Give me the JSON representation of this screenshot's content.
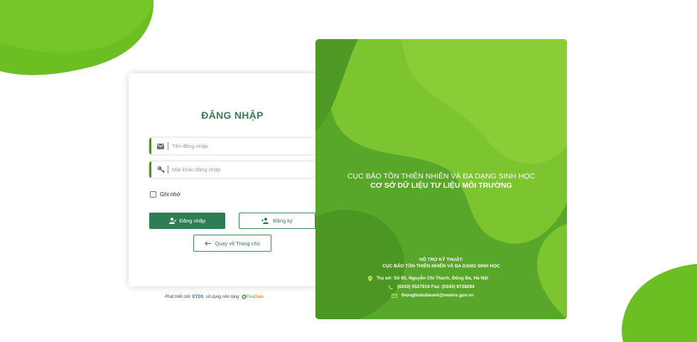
{
  "login": {
    "title": "ĐĂNG NHẬP",
    "username_placeholder": "Tên đăng nhập",
    "password_placeholder": "Mật khẩu đăng nhập",
    "remember_label": "Ghi nhớ",
    "login_button": "Đăng nhập",
    "register_button": "Đăng ký",
    "home_button": "Quay về Trang chủ"
  },
  "footer": {
    "developed_by": "Phát triển bởi",
    "developer_logo": "ETDS",
    "platform_text": "sử dụng nền tảng",
    "platform_logo_a": "Flex",
    "platform_logo_b": "Data"
  },
  "panel": {
    "title_line1": "CỤC BẢO TỒN THIÊN NHIÊN VÀ ĐA DẠNG SINH HỌC",
    "title_line2": "CƠ SỞ DỮ LIỆU TƯ LIỆU MÔI TRƯỜNG",
    "support_heading": "HỖ TRỢ KỸ THUẬT:",
    "support_org": "CỤC BẢO TỒN THIÊN NHIÊN VÀ ĐA DẠNG SINH HỌC",
    "address": "Trụ sở: Số 83, Nguyễn Chí Thanh, Đống Đa, Hà Nội",
    "phone": "(0243) 5527919 Fax: (0243) 8728294",
    "email": "thongtindulieumt@monre.gov.vn"
  },
  "colors": {
    "brand_green": "#2f7d52",
    "accent_green": "#6cbf22",
    "panel_green": "#5aa82a"
  }
}
